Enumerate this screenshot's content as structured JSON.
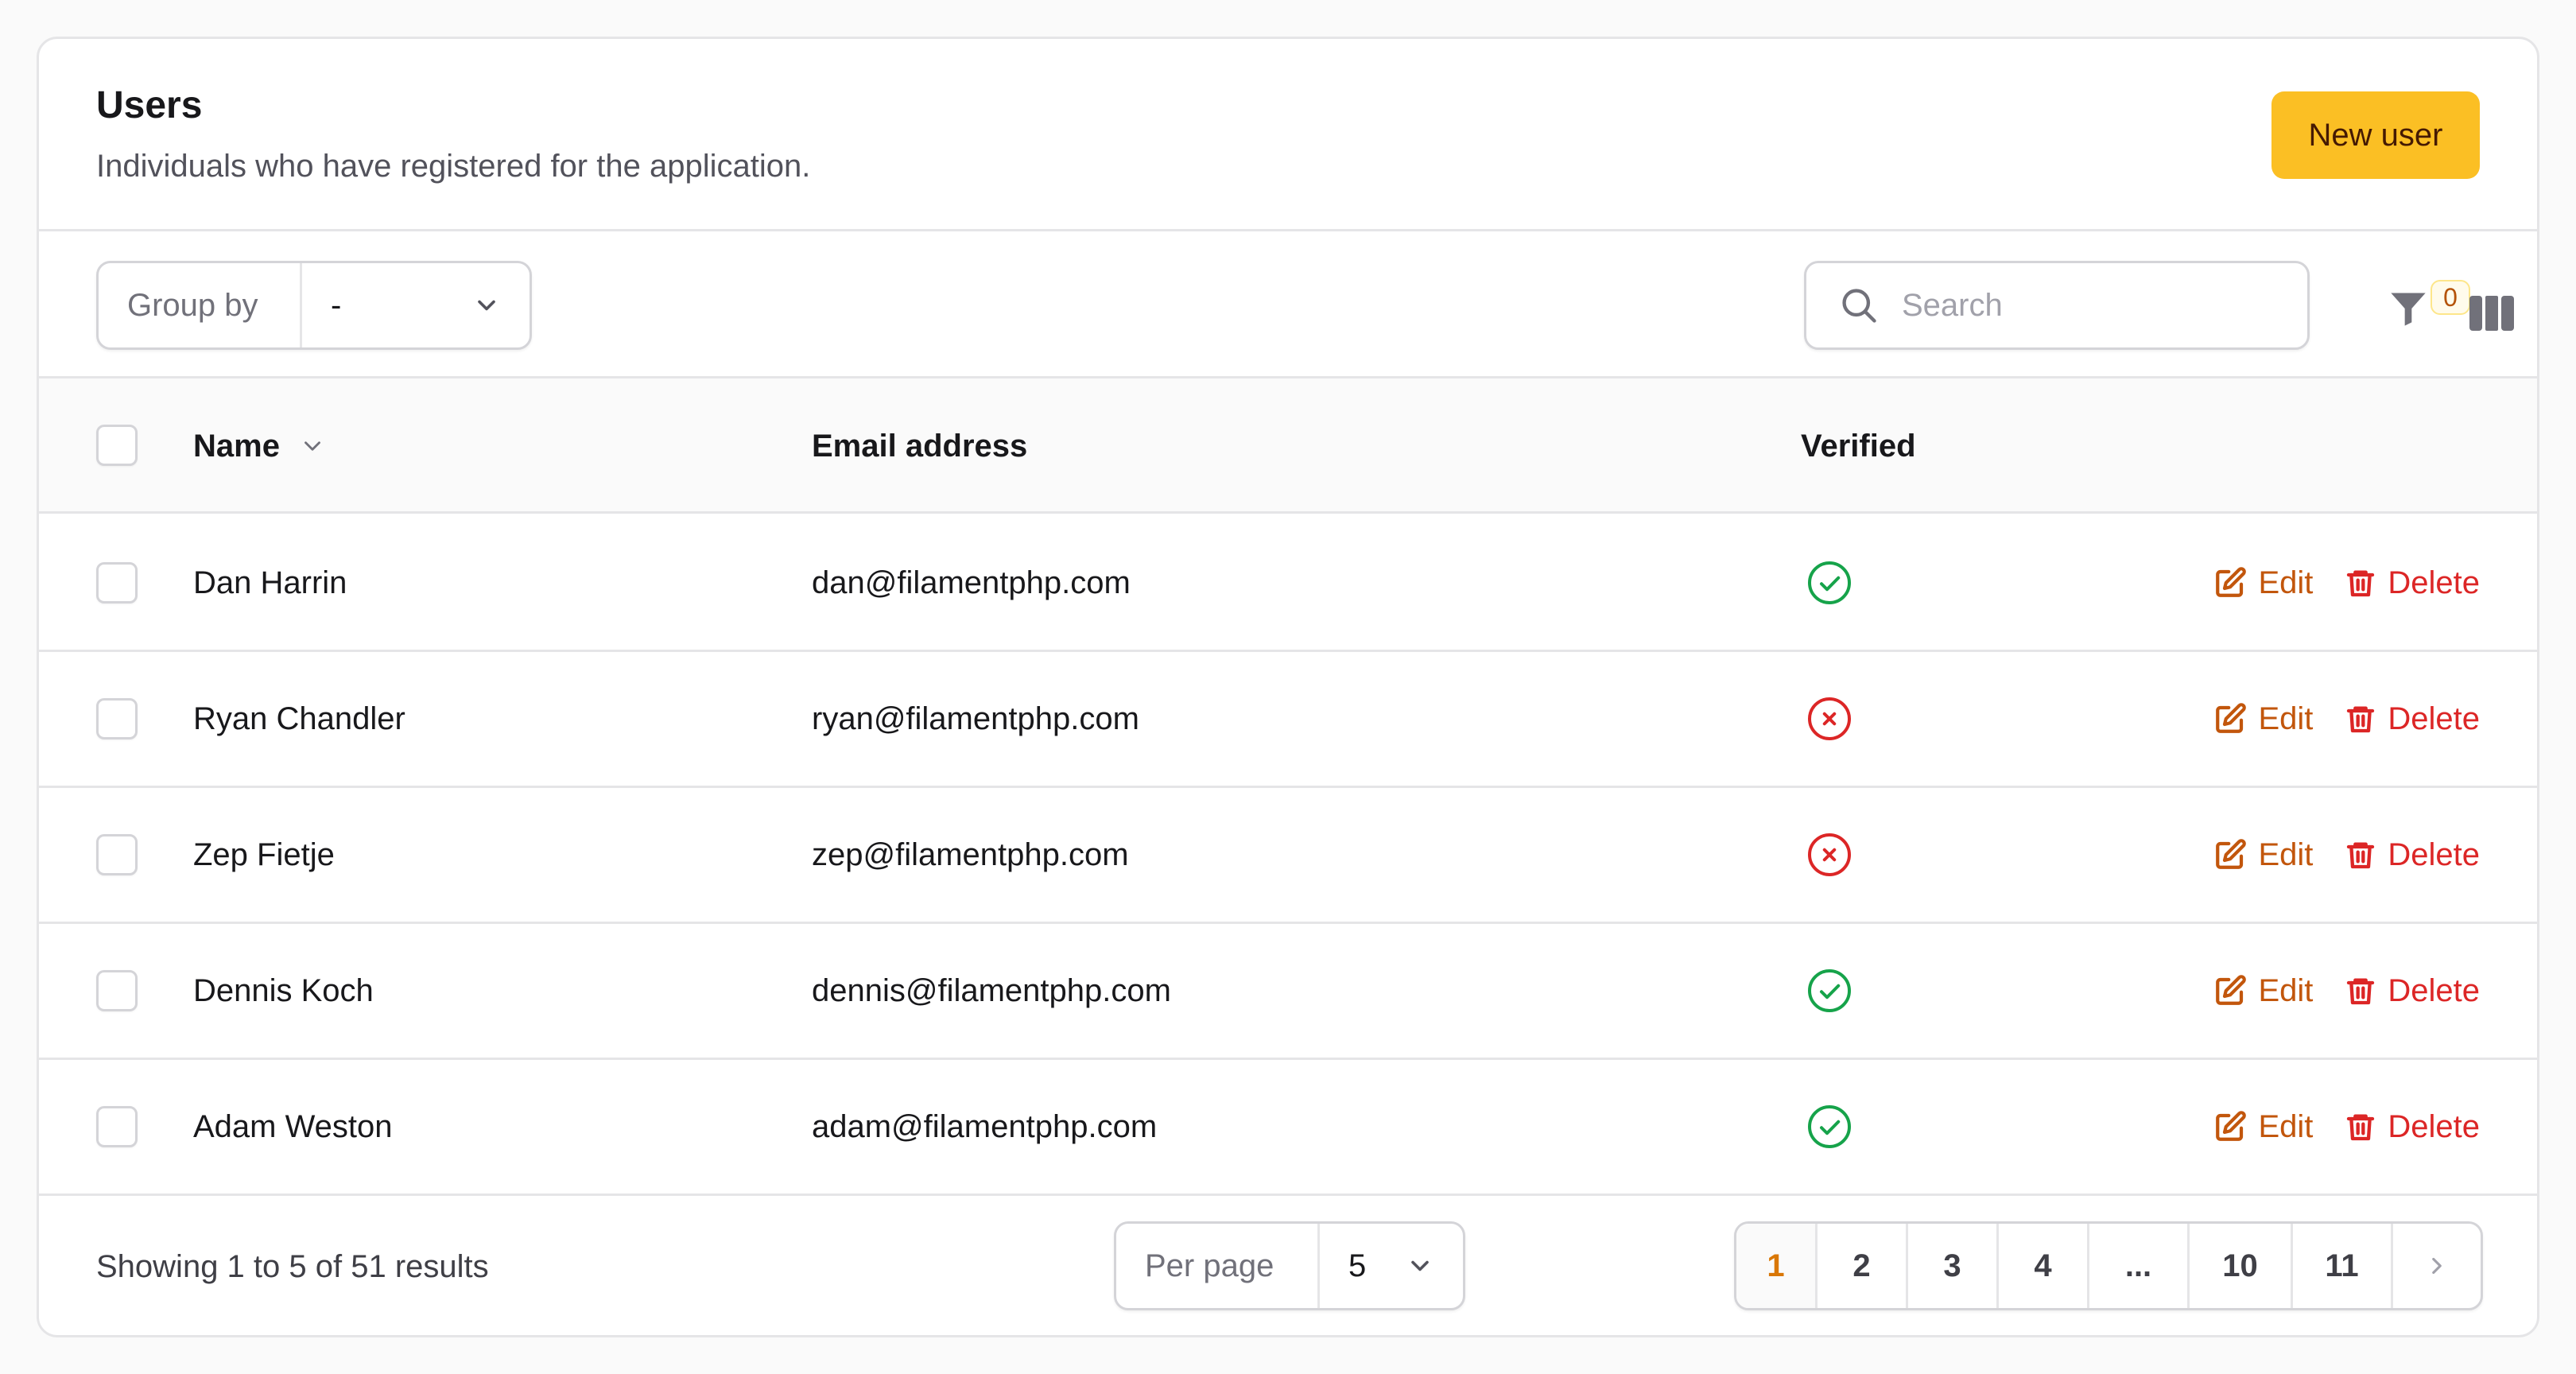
{
  "header": {
    "title": "Users",
    "subtitle": "Individuals who have registered for the application.",
    "new_button": "New user"
  },
  "toolbar": {
    "group_by_label": "Group by",
    "group_by_value": "-",
    "search_placeholder": "Search",
    "filter_count": "0"
  },
  "table": {
    "columns": {
      "name": "Name",
      "email": "Email address",
      "verified": "Verified"
    },
    "rows": [
      {
        "name": "Dan Harrin",
        "email": "dan@filamentphp.com",
        "verified": true
      },
      {
        "name": "Ryan Chandler",
        "email": "ryan@filamentphp.com",
        "verified": false
      },
      {
        "name": "Zep Fietje",
        "email": "zep@filamentphp.com",
        "verified": false
      },
      {
        "name": "Dennis Koch",
        "email": "dennis@filamentphp.com",
        "verified": true
      },
      {
        "name": "Adam Weston",
        "email": "adam@filamentphp.com",
        "verified": true
      }
    ],
    "edit_label": "Edit",
    "delete_label": "Delete"
  },
  "footer": {
    "showing": "Showing 1 to 5 of 51 results",
    "per_page_label": "Per page",
    "per_page_value": "5",
    "pages": [
      "1",
      "2",
      "3",
      "4",
      "...",
      "10",
      "11"
    ],
    "active_page": "1"
  },
  "colors": {
    "accent": "#fbbf24",
    "edit": "#c2560c",
    "delete": "#dc2626",
    "verified": "#16a34a",
    "unverified": "#dc2626"
  },
  "icons": [
    "chevron-down-icon",
    "search-icon",
    "filter-icon",
    "columns-icon",
    "sort-chevron-icon",
    "check-circle-icon",
    "x-circle-icon",
    "edit-icon",
    "trash-icon",
    "chevron-right-icon"
  ]
}
